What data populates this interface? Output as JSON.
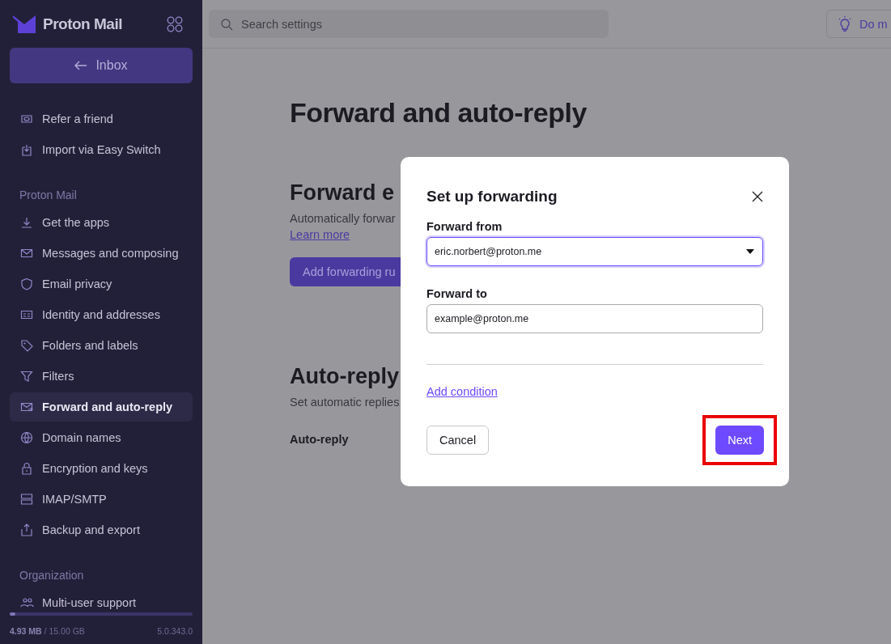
{
  "sidebar": {
    "logo": "Proton Mail",
    "back_button": "Inbox",
    "sections": [
      {
        "items": [
          {
            "label": "Refer a friend",
            "selected": false
          },
          {
            "label": "Import via Easy Switch",
            "selected": false
          }
        ]
      },
      {
        "heading": "Proton Mail",
        "items": [
          {
            "label": "Get the apps",
            "selected": false
          },
          {
            "label": "Messages and composing",
            "selected": false
          },
          {
            "label": "Email privacy",
            "selected": false
          },
          {
            "label": "Identity and addresses",
            "selected": false
          },
          {
            "label": "Folders and labels",
            "selected": false
          },
          {
            "label": "Filters",
            "selected": false
          },
          {
            "label": "Forward and auto-reply",
            "selected": true
          },
          {
            "label": "Domain names",
            "selected": false
          },
          {
            "label": "Encryption and keys",
            "selected": false
          },
          {
            "label": "IMAP/SMTP",
            "selected": false
          },
          {
            "label": "Backup and export",
            "selected": false
          }
        ]
      },
      {
        "heading": "Organization",
        "items": [
          {
            "label": "Multi-user support",
            "selected": false
          }
        ]
      }
    ],
    "storage": {
      "level": 0.03,
      "usage": "**4.93 MB** / 15.00 GB",
      "version": "5.0.343.0"
    }
  },
  "header": {
    "search": {
      "placeholder": "Search settings"
    },
    "tip_button": "Do m"
  },
  "page": {
    "title": "Forward and auto-reply",
    "forward_section": {
      "heading": "Forward e",
      "description": "Automatically forwar",
      "link": "Learn more",
      "button": "Add forwarding ru"
    },
    "auto_reply_section": {
      "heading": "Auto-reply",
      "description": "Set automatic replies",
      "field_label": "Auto-reply"
    }
  },
  "dialog": {
    "title": "Set up forwarding",
    "fields": [
      {
        "kind": "select",
        "label": "Forward from",
        "value": "eric.norbert@proton.me",
        "focused": true
      },
      {
        "kind": "input",
        "label": "Forward to",
        "value": "example@proton.me",
        "focused": false
      }
    ],
    "link": "Add condition",
    "buttons": [
      {
        "label": "Cancel",
        "kind": "secondary",
        "highlighted": false
      },
      {
        "label": "Next",
        "kind": "primary",
        "highlighted": true
      }
    ]
  }
}
